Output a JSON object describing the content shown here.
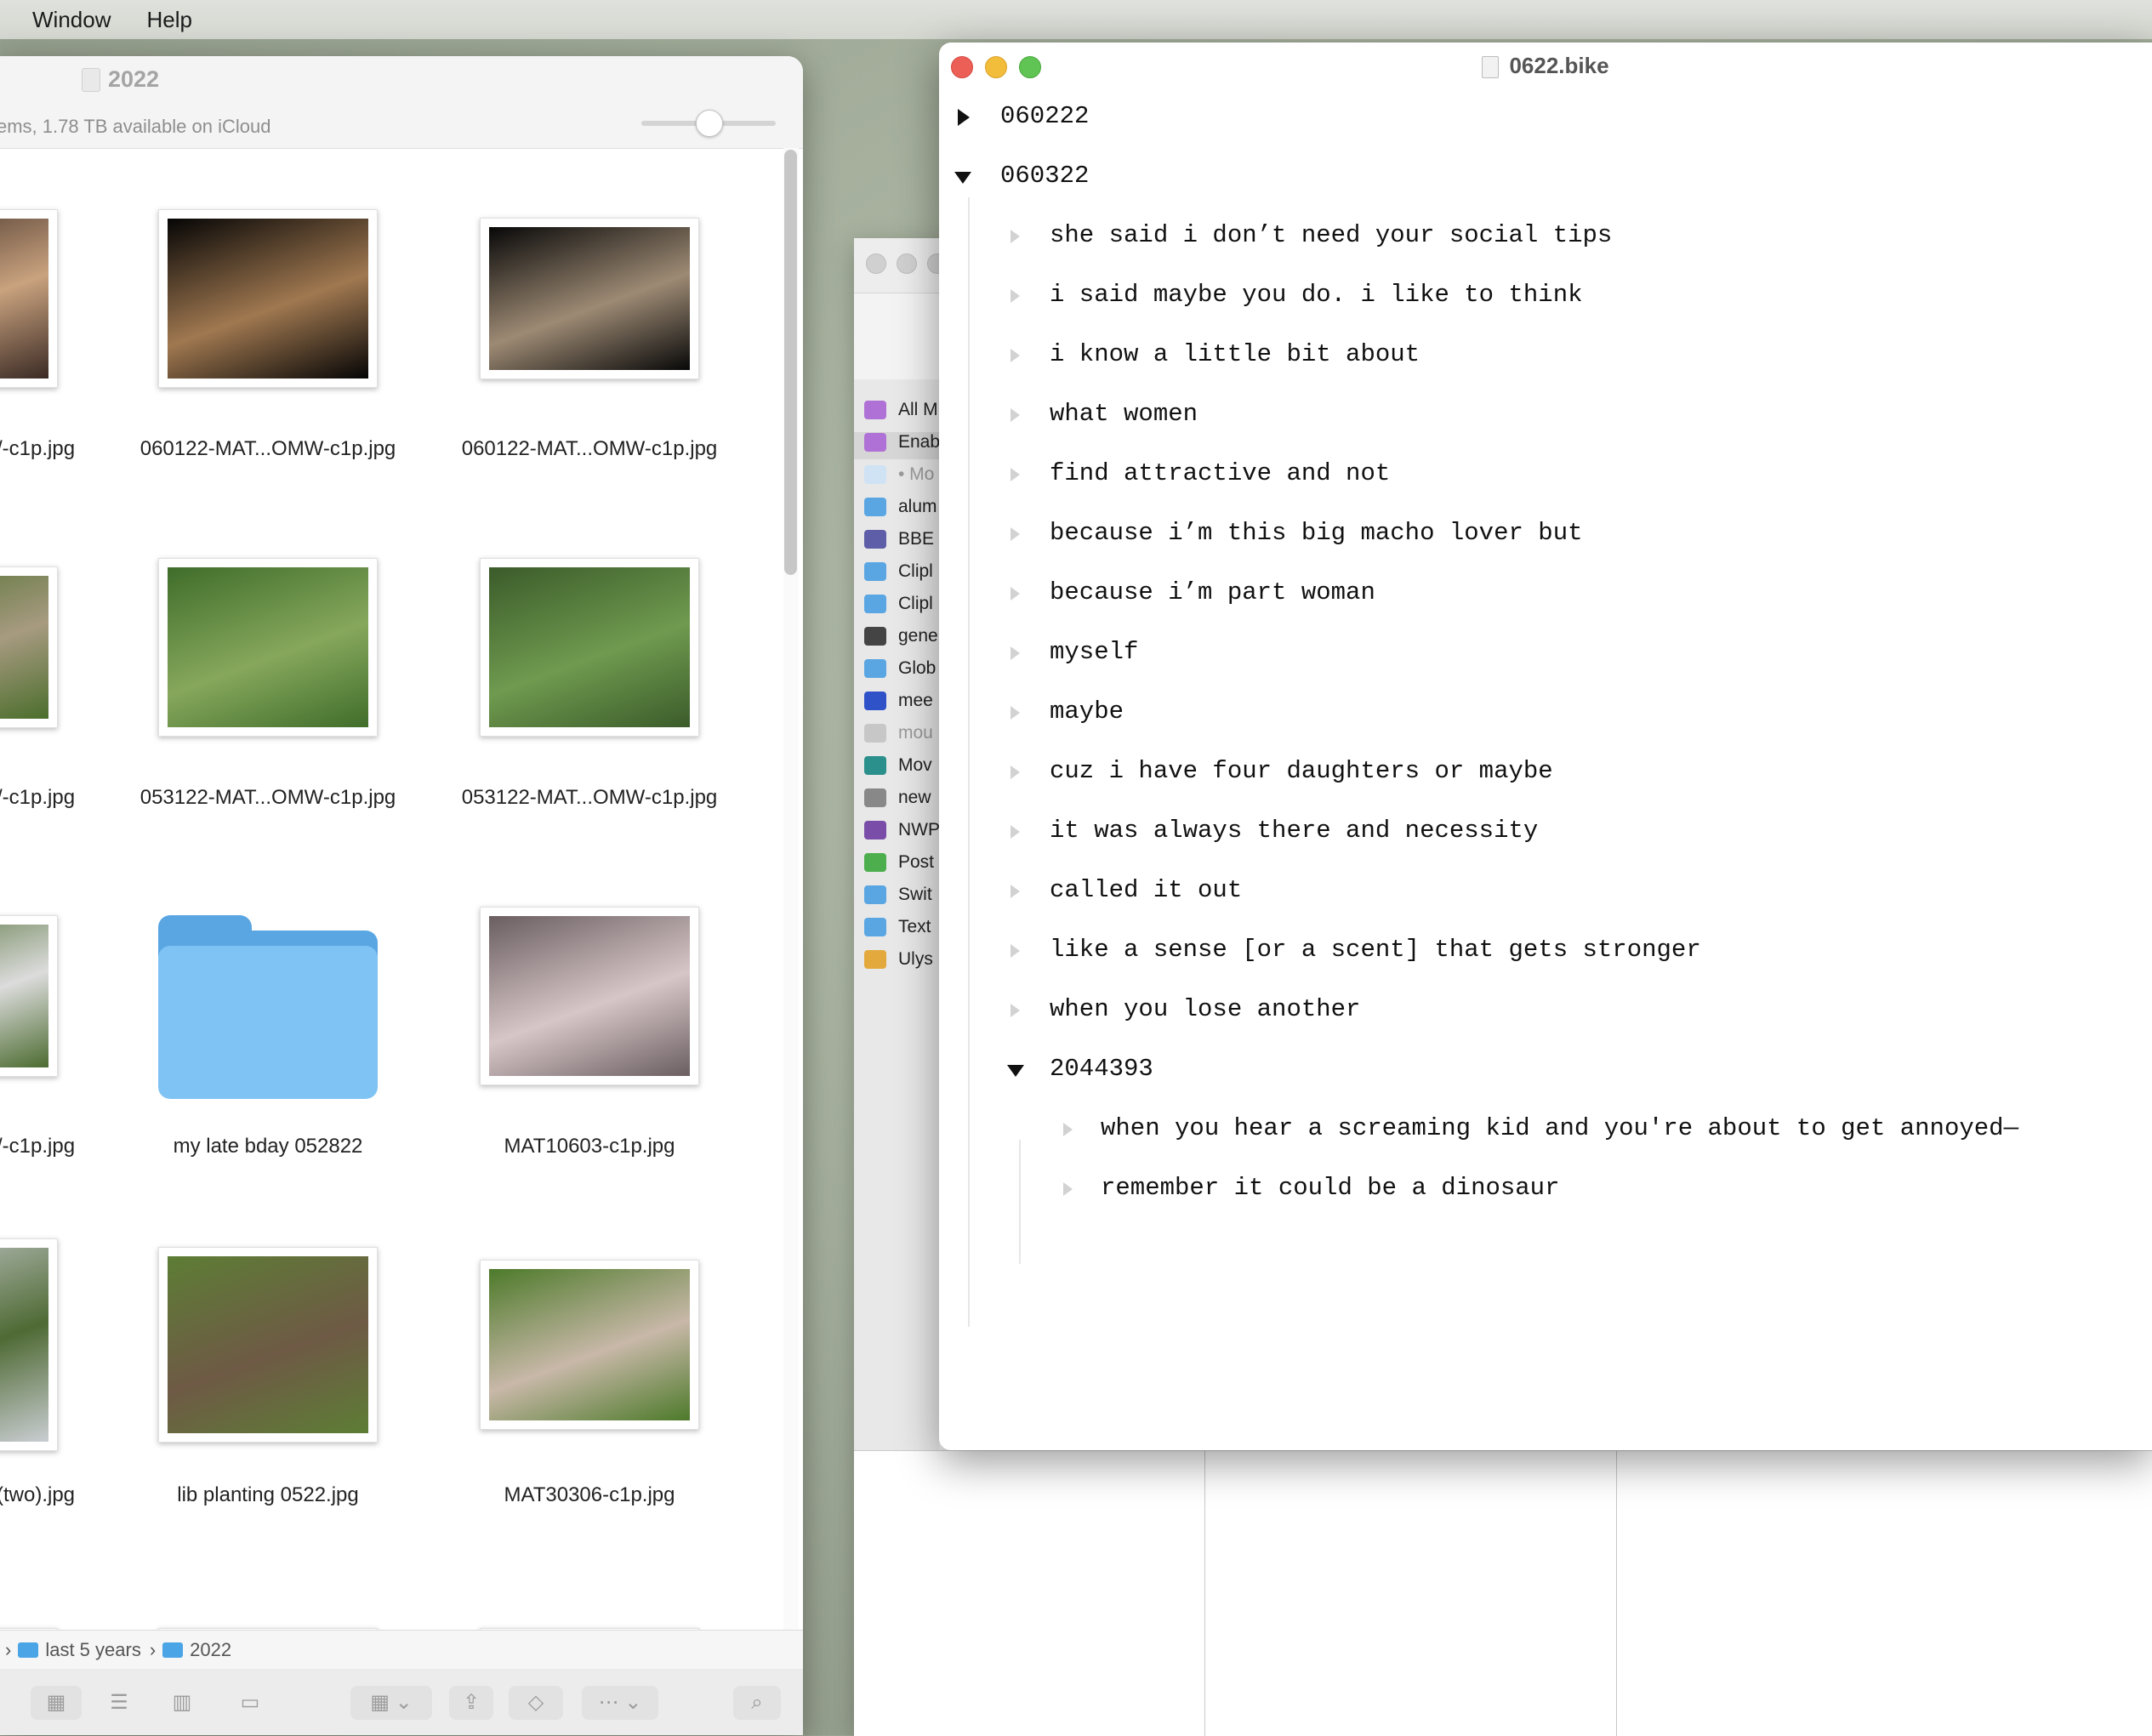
{
  "menubar": {
    "items": [
      "Window",
      "Help"
    ]
  },
  "finder": {
    "title": "2022",
    "status": "ems, 1.78 TB available on iCloud",
    "items": [
      {
        "caption": "/-c1p.jpg",
        "kind": "photo",
        "colors": [
          "#3a2a24",
          "#c9a27e"
        ]
      },
      {
        "caption": "060122-MAT...OMW-c1p.jpg",
        "kind": "photo",
        "colors": [
          "#050505",
          "#a07850"
        ]
      },
      {
        "caption": "060122-MAT...OMW-c1p.jpg",
        "kind": "photo",
        "colors": [
          "#080808",
          "#9d8a74"
        ]
      },
      {
        "caption": "/-c1p.jpg",
        "kind": "photo",
        "colors": [
          "#4b6e2c",
          "#a79a80"
        ]
      },
      {
        "caption": "053122-MAT...OMW-c1p.jpg",
        "kind": "photo",
        "colors": [
          "#3f6d2a",
          "#86a75c"
        ]
      },
      {
        "caption": "053122-MAT...OMW-c1p.jpg",
        "kind": "photo",
        "colors": [
          "#3b5b2a",
          "#6f9a4f"
        ]
      },
      {
        "caption": "/-c1p.jpg",
        "kind": "photo",
        "colors": [
          "#4c6b30",
          "#dcdcdc"
        ]
      },
      {
        "caption": "my late bday 052822",
        "kind": "folder",
        "colors": [
          "#7ec3f3",
          "#5aa6e3"
        ]
      },
      {
        "caption": "MAT10603-c1p.jpg",
        "kind": "photo",
        "colors": [
          "#6a5e60",
          "#d7c6c8"
        ]
      },
      {
        "caption": "(two).jpg",
        "kind": "photo",
        "colors": [
          "#c9cdd1",
          "#4f6a34"
        ]
      },
      {
        "caption": "lib planting 0522.jpg",
        "kind": "photo",
        "colors": [
          "#5d7d35",
          "#6e5a45"
        ]
      },
      {
        "caption": "MAT30306-c1p.jpg",
        "kind": "photo",
        "colors": [
          "#4d7a2a",
          "#c8b8a8"
        ]
      }
    ],
    "path": [
      "last 5 years",
      "2022"
    ]
  },
  "bgwindow": {
    "sidebar_items": [
      {
        "label": "All M",
        "color": "#b071d6"
      },
      {
        "label": "Enab",
        "color": "#b071d6"
      },
      {
        "label": "• Mo",
        "color": "#cfe3f5"
      },
      {
        "label": "alum",
        "color": "#5aa6e3"
      },
      {
        "label": "BBE",
        "color": "#5d5da8"
      },
      {
        "label": "Clipl",
        "color": "#5aa6e3"
      },
      {
        "label": "Clipl",
        "color": "#5aa6e3"
      },
      {
        "label": "gene",
        "color": "#444444"
      },
      {
        "label": "Glob",
        "color": "#5aa6e3"
      },
      {
        "label": "mee",
        "color": "#2f52c9"
      },
      {
        "label": "mou",
        "color": "#c7c7c7"
      },
      {
        "label": "Mov",
        "color": "#2b8f8c"
      },
      {
        "label": "new",
        "color": "#888888"
      },
      {
        "label": "NWP",
        "color": "#7a4ea8"
      },
      {
        "label": "Post",
        "color": "#4cae4c"
      },
      {
        "label": "Swit",
        "color": "#5aa6e3"
      },
      {
        "label": "Text",
        "color": "#5aa6e3"
      },
      {
        "label": "Ulys",
        "color": "#e3a93c"
      }
    ]
  },
  "bike": {
    "title": "0622.bike",
    "rows": [
      {
        "text": "060222",
        "level": 0,
        "state": "collapsed"
      },
      {
        "text": "060322",
        "level": 0,
        "state": "expanded"
      },
      {
        "text": "she said i don’t need your social tips",
        "level": 1,
        "state": "leaf"
      },
      {
        "text": "i said maybe you do. i like to think",
        "level": 1,
        "state": "leaf"
      },
      {
        "text": "i know a little bit about",
        "level": 1,
        "state": "leaf"
      },
      {
        "text": "what women",
        "level": 1,
        "state": "leaf"
      },
      {
        "text": "find attractive and not",
        "level": 1,
        "state": "leaf"
      },
      {
        "text": "because i’m this big macho lover but",
        "level": 1,
        "state": "leaf"
      },
      {
        "text": "because i’m part woman",
        "level": 1,
        "state": "leaf"
      },
      {
        "text": "myself",
        "level": 1,
        "state": "leaf"
      },
      {
        "text": "maybe",
        "level": 1,
        "state": "leaf"
      },
      {
        "text": "cuz i have four daughters or maybe",
        "level": 1,
        "state": "leaf"
      },
      {
        "text": "it was always there and necessity",
        "level": 1,
        "state": "leaf"
      },
      {
        "text": "called it out",
        "level": 1,
        "state": "leaf"
      },
      {
        "text": "like a sense [or a scent] that gets stronger",
        "level": 1,
        "state": "leaf"
      },
      {
        "text": "when you lose another",
        "level": 1,
        "state": "leaf"
      },
      {
        "text": "2044393",
        "level": 1,
        "state": "expanded"
      },
      {
        "text": "when you hear a screaming kid and you're about to get annoyed—",
        "level": 2,
        "state": "leaf"
      },
      {
        "text": "remember it could be a dinosaur",
        "level": 2,
        "state": "leaf"
      }
    ]
  }
}
